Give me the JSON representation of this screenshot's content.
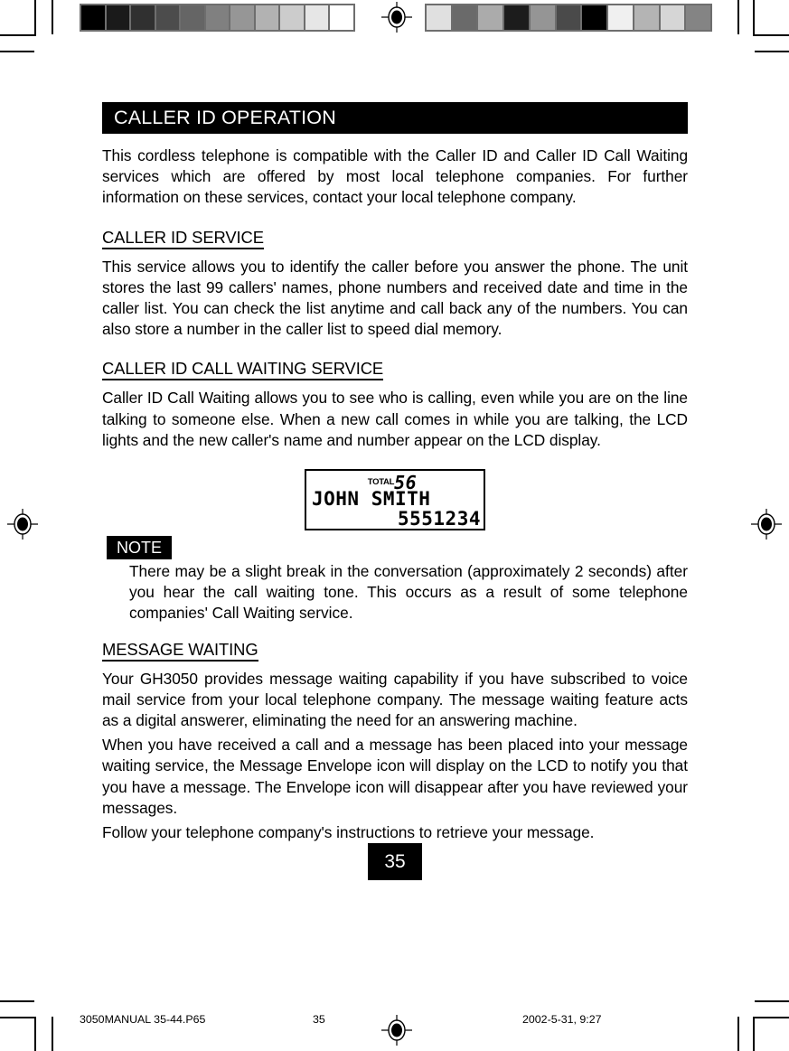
{
  "document": {
    "page_label": "35",
    "banner_title": "CALLER ID OPERATION"
  },
  "intro": {
    "paragraph": "This cordless telephone is compatible with the Caller ID and Caller ID Call Waiting services which are offered by most local telephone companies. For further information on these services, contact your local telephone company."
  },
  "sections": [
    {
      "heading": "CALLER ID SERVICE",
      "paragraph": "This service allows you to identify the caller before you answer the phone. The unit stores the last 99 callers' names, phone numbers and received date and time in the caller list. You can check the list anytime and call back any of the numbers. You can also store a number in the caller list to speed dial memory."
    },
    {
      "heading": "CALLER ID CALL WAITING SERVICE",
      "paragraph": "Caller ID Call Waiting allows you to see who is calling, even while you are on the line talking to someone else. When a new call comes in while you are talking, the LCD lights and the new caller's name and number appear on the LCD display."
    },
    {
      "heading": "MESSAGE WAITING",
      "paragraph": "Your GH3050 provides message waiting capability if you have subscribed to voice mail service from your local telephone company. The message waiting feature acts as a digital answerer, eliminating the need for an answering machine.",
      "paragraph2": "When you have received a call and a message has been placed into your message waiting service, the Message Envelope icon will display on the LCD to notify you that you have a message. The Envelope icon will disappear after you have reviewed your messages.",
      "paragraph3": "Follow your telephone company's instructions to retrieve your message."
    }
  ],
  "lcd_figure": {
    "total_label": "TOTAL",
    "total_value": "56",
    "caller_name": "JOHN SMITH",
    "caller_number": "5551234"
  },
  "note": {
    "tag": "NOTE",
    "text": "There may be a slight break in the conversation (approximately 2 seconds) after you hear the call waiting tone. This occurs as a result of some telephone companies' Call Waiting service."
  },
  "footer": {
    "file_name": "3050MANUAL 35-44.P65",
    "page_number": "35",
    "timestamp": "2002-5-31, 9:27"
  },
  "calibration": {
    "left_bar_swatches": [
      "#000000",
      "#1a1a1a",
      "#303030",
      "#4c4c4c",
      "#656565",
      "#808080",
      "#969696",
      "#b2b2b2",
      "#cccccc",
      "#e6e6e6",
      "#ffffff"
    ],
    "right_bar_swatches": [
      "#e0e0e0",
      "#6a6a6a",
      "#ababab",
      "#1c1c1c",
      "#959595",
      "#4a4a4a",
      "#000000",
      "#f0f0f0",
      "#b4b4b4",
      "#d6d6d6",
      "#848484"
    ]
  }
}
